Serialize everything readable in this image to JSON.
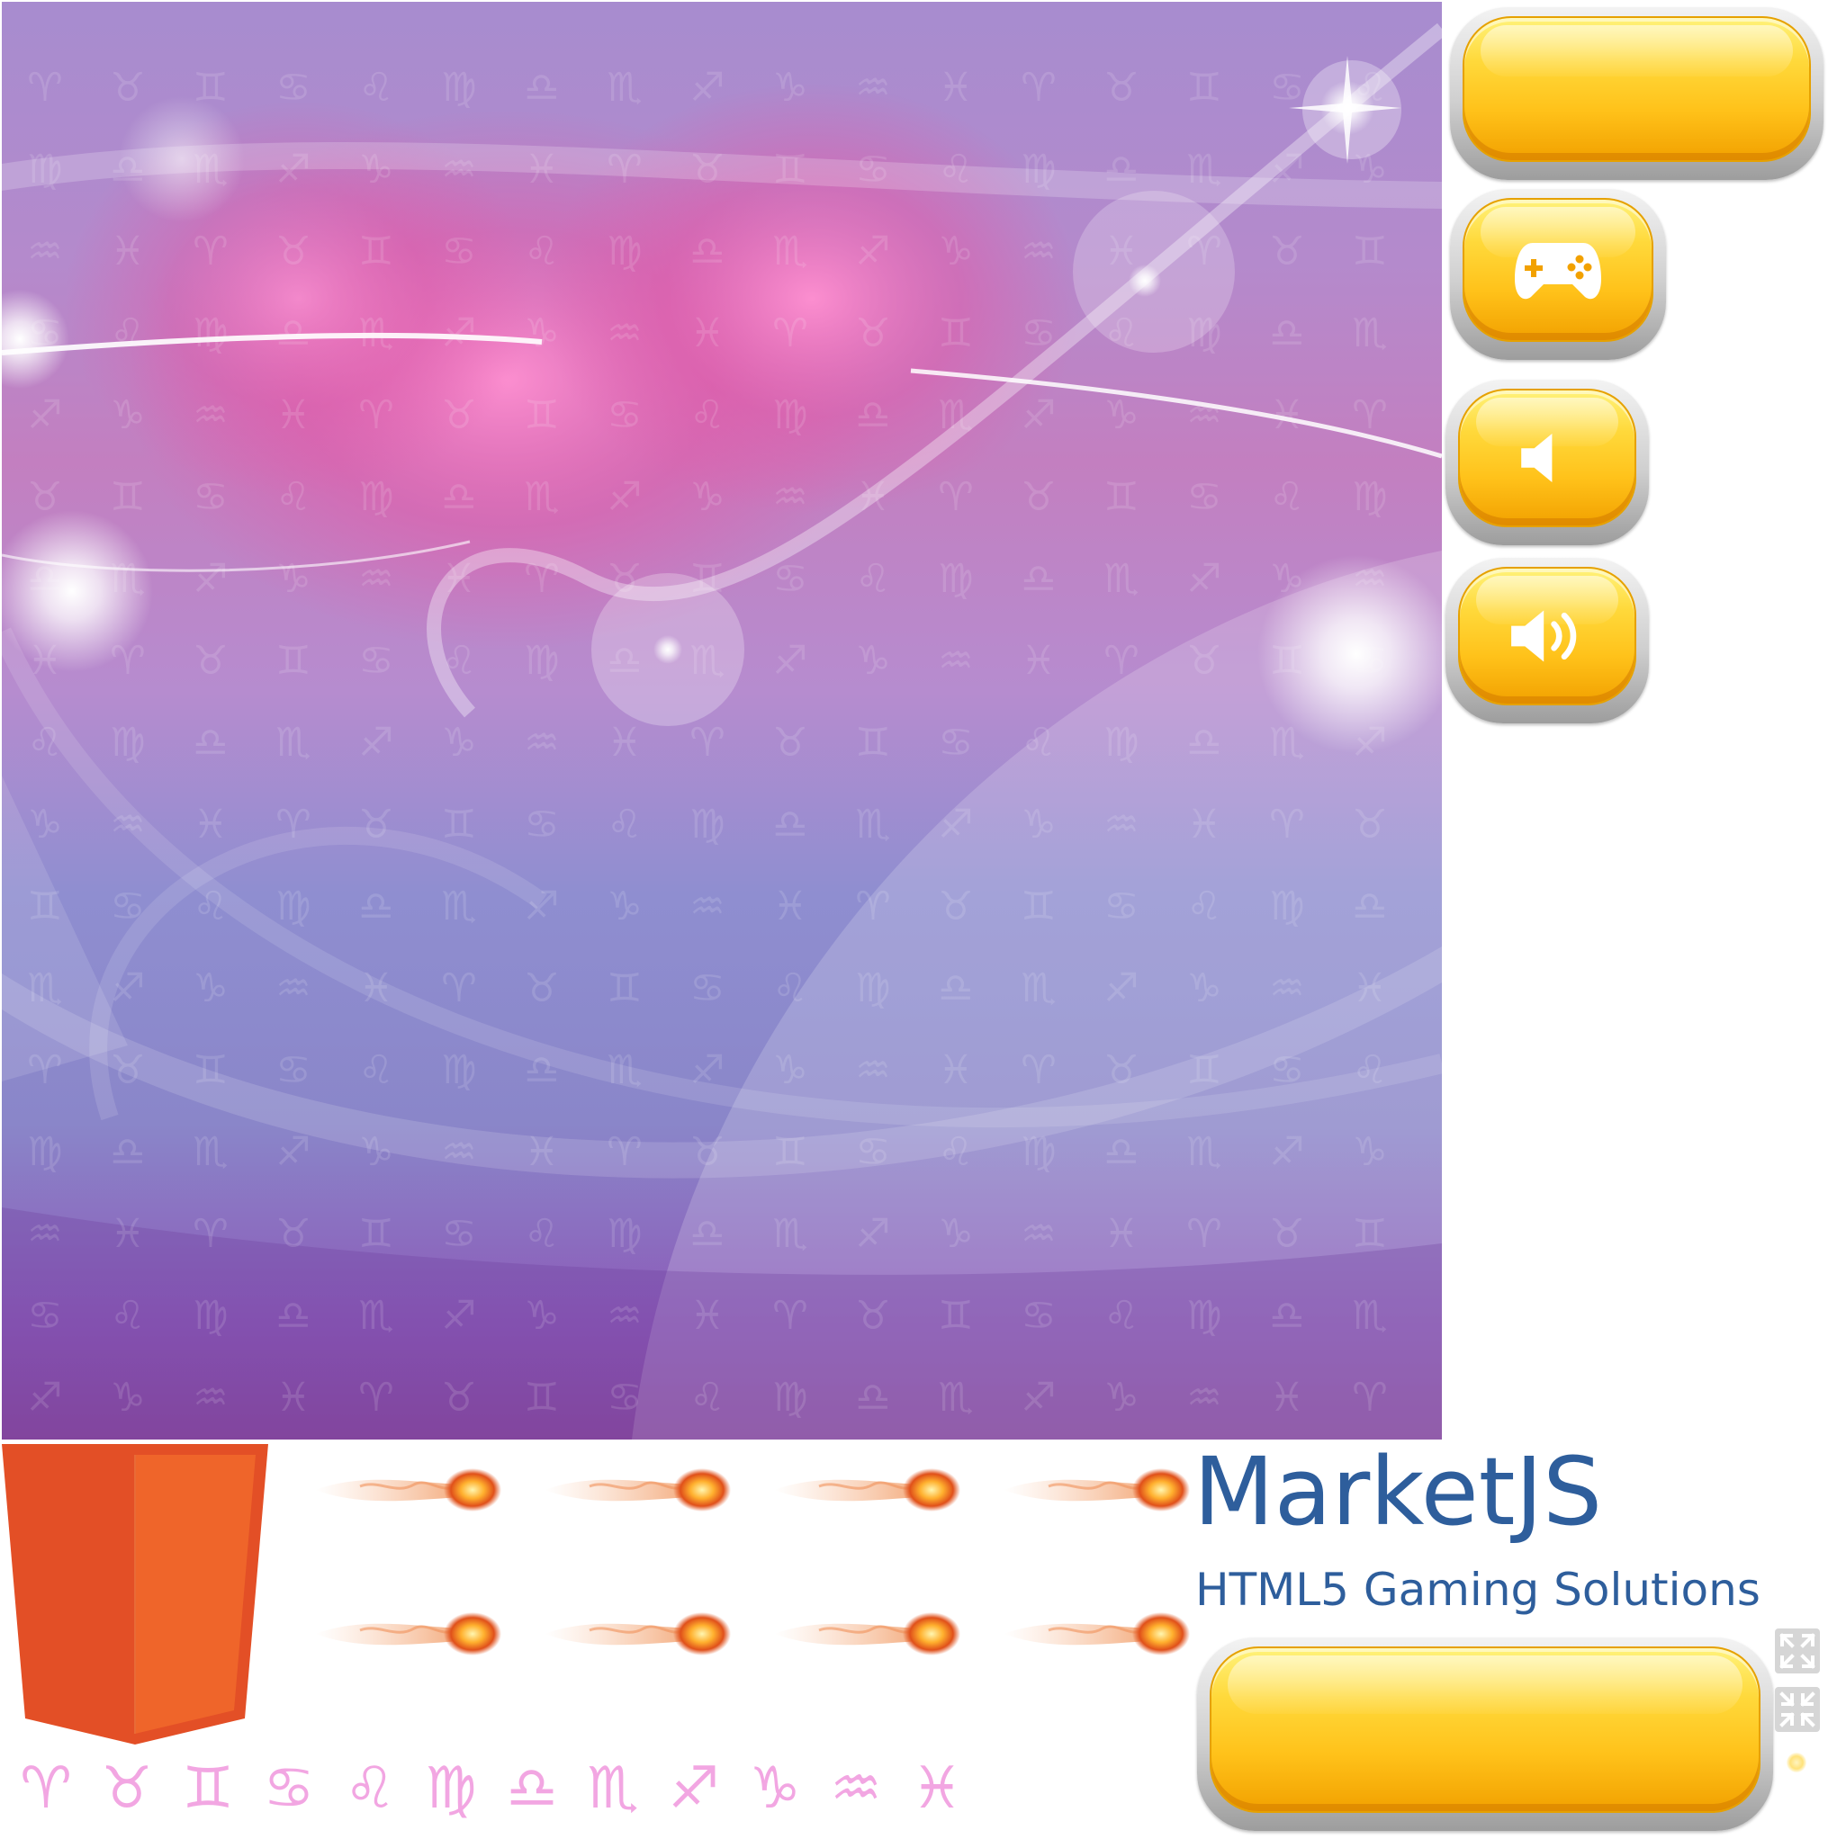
{
  "sprite_sheet": {
    "background": {
      "colors": [
        "#a78ccf",
        "#c37fc0",
        "#8a86c9",
        "#8b4a9f"
      ]
    },
    "buttons": [
      {
        "id": "wide-top",
        "icon": ""
      },
      {
        "id": "play",
        "icon": "gamepad-icon"
      },
      {
        "id": "sound-off",
        "icon": "speaker-muted-icon"
      },
      {
        "id": "sound-on",
        "icon": "speaker-on-icon"
      },
      {
        "id": "wide-bottom",
        "icon": ""
      }
    ],
    "button_colors": {
      "top": "#fff27a",
      "mid": "#ffc21a",
      "bottom": "#f2a100",
      "frame": "#cfcfcf"
    },
    "logo": {
      "icon": "html5-shield-icon",
      "colors": [
        "#e34f26",
        "#ef652a"
      ]
    },
    "fireballs": {
      "icon": "fireball-icon",
      "count": 8
    },
    "zodiac": {
      "glyphs": [
        "♈",
        "♉",
        "♊",
        "♋",
        "♌",
        "♍",
        "♎",
        "♏",
        "♐",
        "♑",
        "♒",
        "♓"
      ],
      "color": "#f2a6e2"
    },
    "branding": {
      "title": "MarketJS",
      "subtitle": "HTML5 Gaming Solutions",
      "color": "#2e5e9c"
    },
    "fullscreen_icons": [
      "expand-icon",
      "collapse-icon"
    ]
  }
}
